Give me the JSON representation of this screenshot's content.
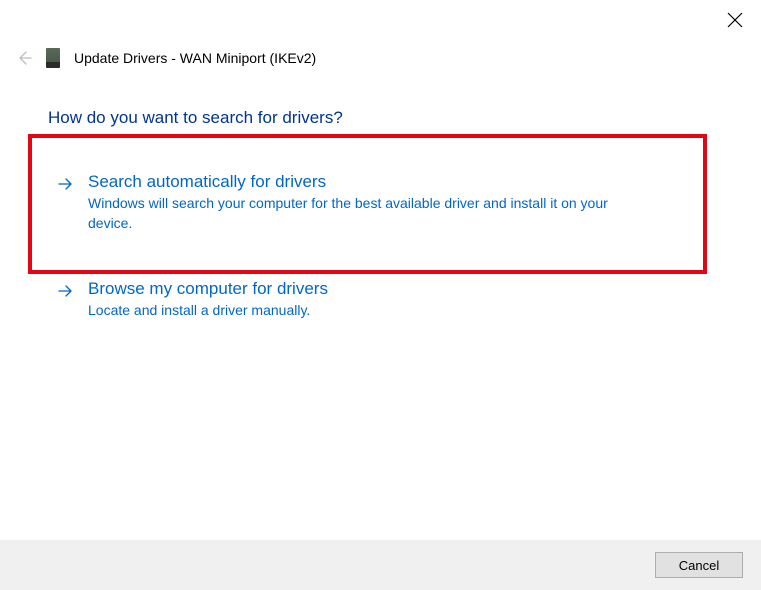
{
  "window": {
    "title": "Update Drivers - WAN Miniport (IKEv2)"
  },
  "heading": "How do you want to search for drivers?",
  "options": [
    {
      "title": "Search automatically for drivers",
      "description": "Windows will search your computer for the best available driver and install it on your device."
    },
    {
      "title": "Browse my computer for drivers",
      "description": "Locate and install a driver manually."
    }
  ],
  "footer": {
    "cancel": "Cancel"
  }
}
